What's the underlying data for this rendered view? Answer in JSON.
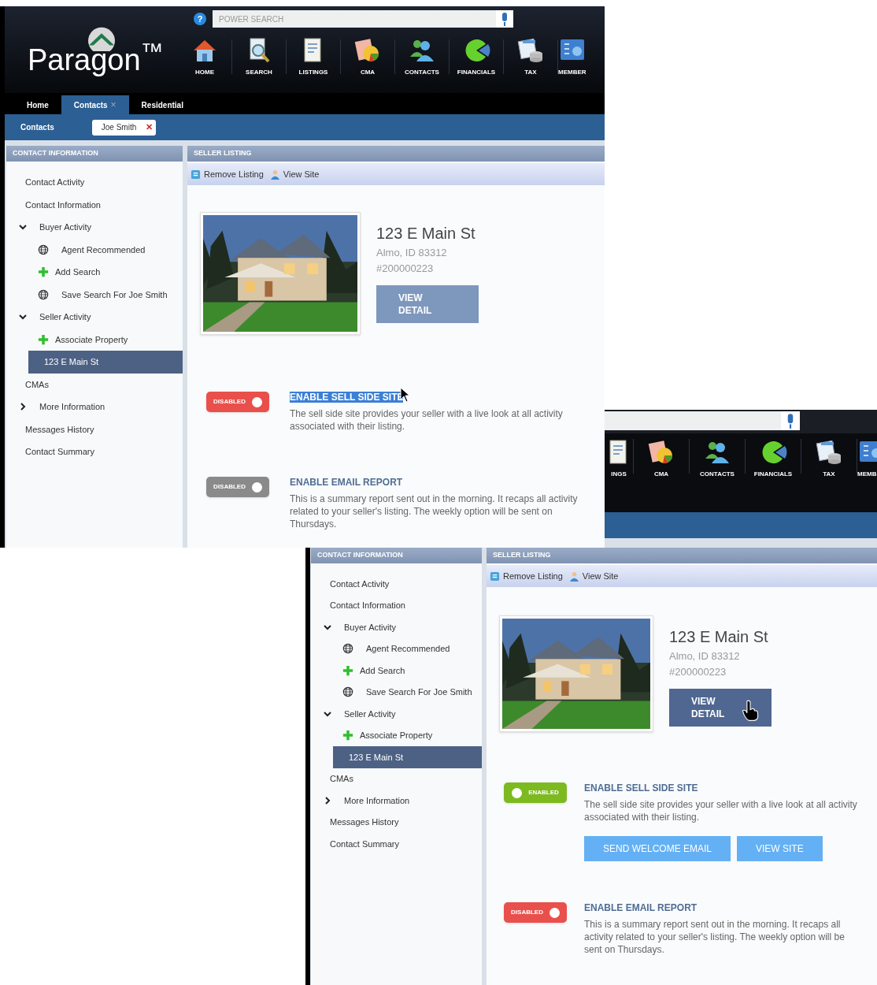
{
  "screens": [
    {
      "kind": "full",
      "logo": "Paragon$^{™}$",
      "help": "?",
      "search": {
        "placeholder": "POWER SEARCH"
      },
      "nav": [
        {
          "kind": "home",
          "label": "HOME"
        },
        {
          "kind": "search",
          "label": "SEARCH"
        },
        {
          "kind": "listings",
          "label": "LISTINGS"
        },
        {
          "kind": "cma",
          "label": "CMA"
        },
        {
          "kind": "contacts",
          "label": "CONTACTS"
        },
        {
          "kind": "financials",
          "label": "FINANCIALS"
        },
        {
          "kind": "tax",
          "label": "TAX"
        },
        {
          "kind": "members",
          "label": "MEMBER"
        }
      ],
      "tabs": [
        {
          "label": "Home",
          "selected": false
        },
        {
          "label": "Contacts",
          "selected": true,
          "close": "×"
        },
        {
          "label": "Residential",
          "selected": false
        }
      ],
      "subbar": {
        "label": "Contacts",
        "chip": "Joe Smith",
        "chip_close": "✕"
      },
      "sidebar": {
        "title": "CONTACT INFORMATION",
        "items": [
          {
            "kind": "link",
            "label": "Contact Activity",
            "selected": false
          },
          {
            "kind": "link",
            "label": "Contact Information",
            "selected": false
          },
          {
            "kind": "group",
            "label": "Buyer Activity",
            "selected": false,
            "expanded": true,
            "children": [
              {
                "kind": "globe",
                "label": "Agent Recommended",
                "selected": false
              },
              {
                "kind": "add",
                "label": "Add Search",
                "selected": false
              },
              {
                "kind": "globe",
                "label": "Save Search For Joe Smith",
                "selected": false
              }
            ]
          },
          {
            "kind": "group",
            "label": "Seller Activity",
            "selected": false,
            "expanded": true,
            "children": [
              {
                "kind": "add",
                "label": "Associate Property",
                "selected": false
              },
              {
                "kind": "link",
                "label": "123 E Main St",
                "selected": true
              }
            ]
          },
          {
            "kind": "link",
            "label": "CMAs",
            "selected": false
          },
          {
            "kind": "group",
            "label": "More Information",
            "selected": false,
            "expanded": false
          },
          {
            "kind": "link",
            "label": "Messages History",
            "selected": false
          },
          {
            "kind": "link",
            "label": "Contact Summary",
            "selected": false
          }
        ]
      },
      "listing": {
        "title": "SELLER LISTING",
        "tools": [
          {
            "kind": "remove",
            "label": "Remove Listing"
          },
          {
            "kind": "site",
            "label": "View Site"
          }
        ],
        "address": "123 E Main St",
        "city": "Almo, ID 83312",
        "number": "#200000223",
        "view_button": {
          "label": "VIEW DETAIL",
          "hovered": false
        },
        "features": [
          {
            "title": "ENABLE SELL SIDE SITE",
            "highlighted": true,
            "cursor": {
              "kind": "arrow"
            },
            "description": "The sell side site provides your seller with a live look at all activity associated with their listing.",
            "toggle": {
              "label": "DISABLED",
              "on": false,
              "greyed": false
            }
          },
          {
            "title": "ENABLE EMAIL REPORT",
            "highlighted": false,
            "description": "This is a summary report sent out in the morning. It recaps all activity related to your seller's listing. The weekly option will be sent on Thursdays.",
            "toggle": {
              "label": "DISABLED",
              "on": false,
              "greyed": true
            }
          }
        ]
      }
    },
    {
      "kind": "partial",
      "nav": [
        {
          "kind": "listings",
          "label": "INGS"
        },
        {
          "kind": "cma",
          "label": "CMA"
        },
        {
          "kind": "contacts",
          "label": "CONTACTS"
        },
        {
          "kind": "financials",
          "label": "FINANCIALS"
        },
        {
          "kind": "tax",
          "label": "TAX"
        },
        {
          "kind": "members",
          "label": "MEMB"
        }
      ],
      "sidebar": {
        "title": "CONTACT INFORMATION",
        "items": [
          {
            "kind": "link",
            "label": "Contact Activity",
            "selected": false
          },
          {
            "kind": "link",
            "label": "Contact Information",
            "selected": false
          },
          {
            "kind": "group",
            "label": "Buyer Activity",
            "selected": false,
            "expanded": true,
            "children": [
              {
                "kind": "globe",
                "label": "Agent Recommended",
                "selected": false
              },
              {
                "kind": "add",
                "label": "Add Search",
                "selected": false
              },
              {
                "kind": "globe",
                "label": "Save Search For Joe Smith",
                "selected": false
              }
            ]
          },
          {
            "kind": "group",
            "label": "Seller Activity",
            "selected": false,
            "expanded": true,
            "children": [
              {
                "kind": "add",
                "label": "Associate Property",
                "selected": false
              },
              {
                "kind": "link",
                "label": "123 E Main St",
                "selected": true
              }
            ]
          },
          {
            "kind": "link",
            "label": "CMAs",
            "selected": false
          },
          {
            "kind": "group",
            "label": "More Information",
            "selected": false,
            "expanded": false
          },
          {
            "kind": "link",
            "label": "Messages History",
            "selected": false
          },
          {
            "kind": "link",
            "label": "Contact Summary",
            "selected": false
          }
        ]
      },
      "listing": {
        "title": "SELLER LISTING",
        "tools": [
          {
            "kind": "remove",
            "label": "Remove Listing"
          },
          {
            "kind": "site",
            "label": "View Site"
          }
        ],
        "address": "123 E Main St",
        "city": "Almo, ID 83312",
        "number": "#200000223",
        "view_button": {
          "label": "VIEW DETAIL",
          "hovered": true,
          "cursor": {
            "kind": "hand"
          }
        },
        "features": [
          {
            "title": "ENABLE SELL SIDE SITE",
            "highlighted": false,
            "description": "The sell side site provides your seller with a live look at all activity associated with their listing.",
            "toggle": {
              "label": "ENABLED",
              "on": true,
              "greyed": false
            },
            "buttons": [
              "SEND WELCOME EMAIL",
              "VIEW SITE"
            ]
          },
          {
            "title": "ENABLE EMAIL REPORT",
            "highlighted": false,
            "description": "This is a summary report sent out in the morning. It recaps all activity related to your seller's listing. The weekly option will be sent on Thursdays.",
            "toggle": {
              "label": "DISABLED",
              "on": false,
              "greyed": false
            }
          }
        ]
      }
    }
  ]
}
